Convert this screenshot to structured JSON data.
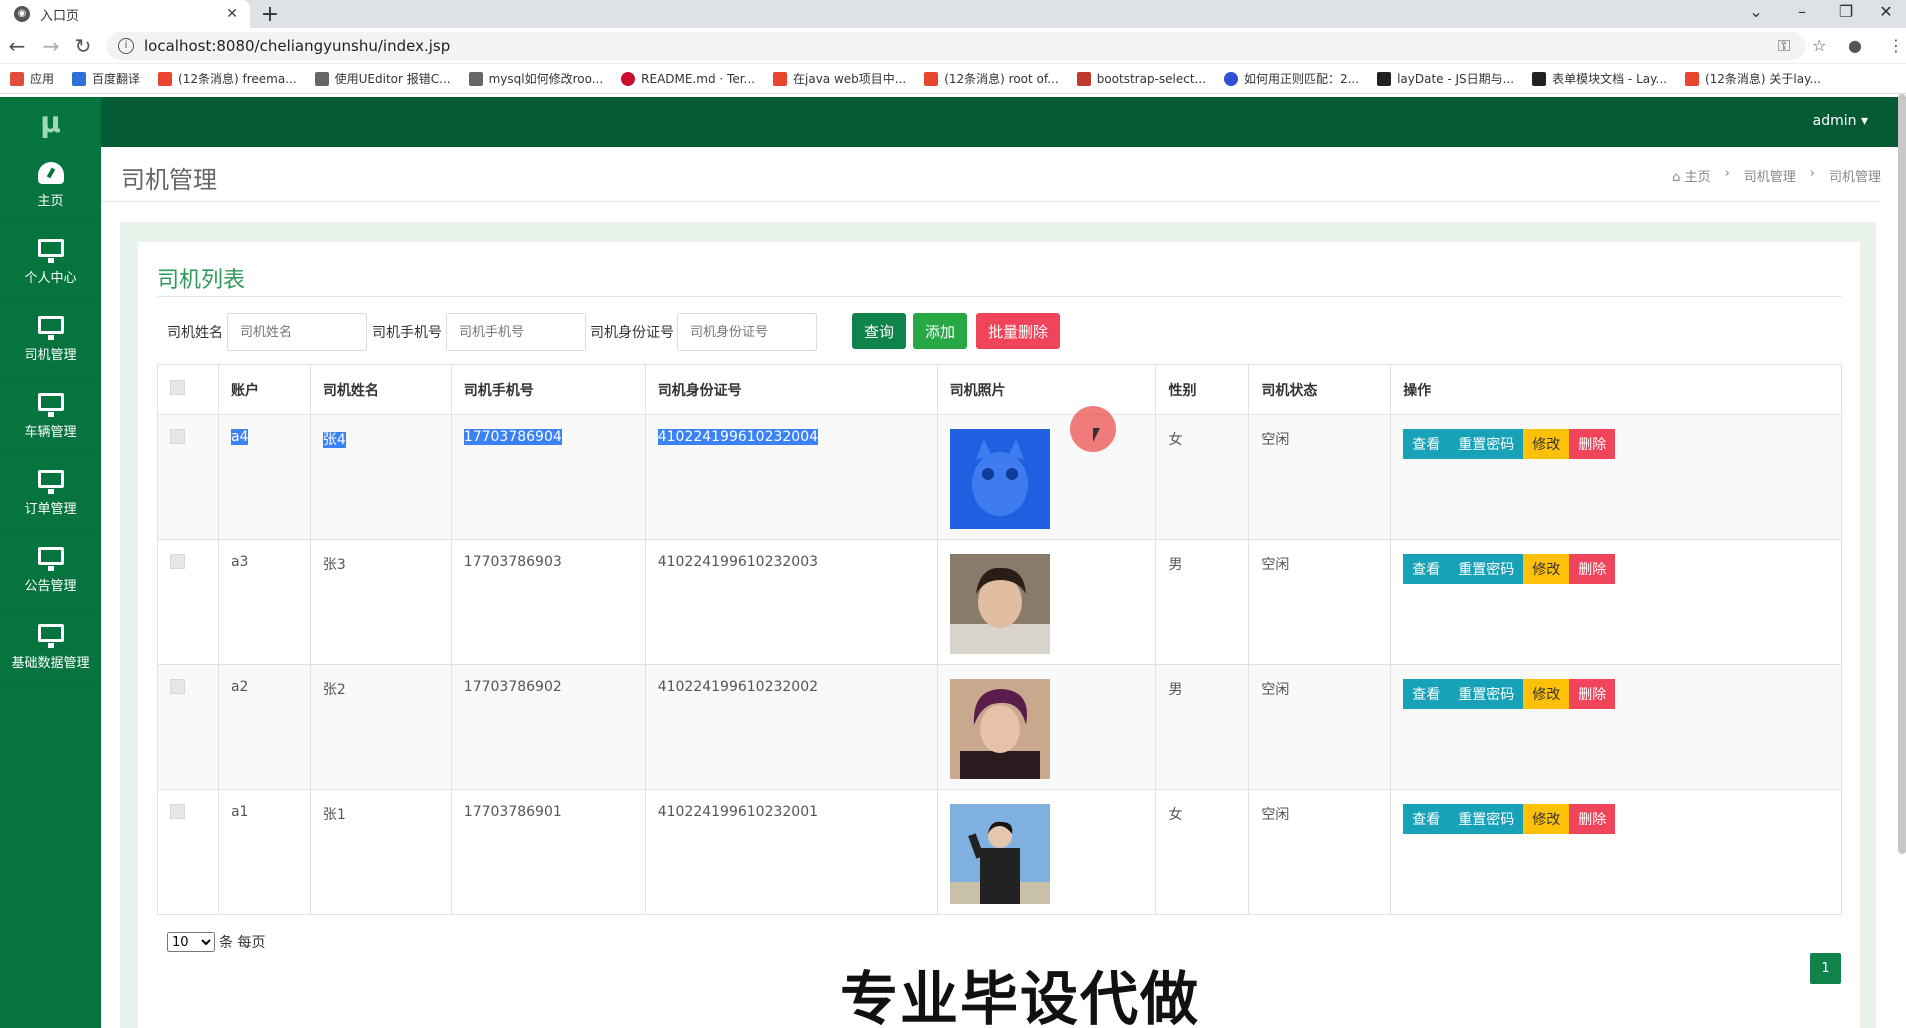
{
  "browser": {
    "tab_title": "入口页",
    "url": "localhost:8080/cheliangyunshu/index.jsp",
    "bookmarks": [
      "应用",
      "百度翻译",
      "(12条消息) freema...",
      "使用UEditor 报错C...",
      "mysql如何修改roo...",
      "README.md · Ter...",
      "在java web项目中...",
      "(12条消息) root of...",
      "bootstrap-select...",
      "如何用正则匹配：2...",
      "layDate - JS日期与...",
      "表单模块文档 - Lay...",
      "(12条消息) 关于lay..."
    ]
  },
  "sidebar": {
    "logo": "μ",
    "items": [
      {
        "label": "主页",
        "icon": "dashboard-icon"
      },
      {
        "label": "个人中心",
        "icon": "monitor-icon"
      },
      {
        "label": "司机管理",
        "icon": "monitor-icon"
      },
      {
        "label": "车辆管理",
        "icon": "monitor-icon"
      },
      {
        "label": "订单管理",
        "icon": "monitor-icon"
      },
      {
        "label": "公告管理",
        "icon": "monitor-icon"
      },
      {
        "label": "基础数据管理",
        "icon": "monitor-icon"
      }
    ]
  },
  "topbar": {
    "user": "admin ▾"
  },
  "page": {
    "title": "司机管理",
    "breadcrumb": [
      "主页",
      "›",
      "司机管理",
      "›",
      "司机管理"
    ]
  },
  "panel": {
    "title": "司机列表",
    "filters": [
      {
        "label": "司机姓名",
        "placeholder": "司机姓名"
      },
      {
        "label": "司机手机号",
        "placeholder": "司机手机号"
      },
      {
        "label": "司机身份证号",
        "placeholder": "司机身份证号"
      }
    ],
    "buttons": {
      "query": "查询",
      "add": "添加",
      "batch_delete": "批量删除"
    }
  },
  "table": {
    "headers": [
      "账户",
      "司机姓名",
      "司机手机号",
      "司机身份证号",
      "司机照片",
      "性别",
      "司机状态",
      "操作"
    ],
    "rows": [
      {
        "account": "a4",
        "name": "张4",
        "phone": "17703786904",
        "idcard": "410224199610232004",
        "gender": "女",
        "status": "空闲"
      },
      {
        "account": "a3",
        "name": "张3",
        "phone": "17703786903",
        "idcard": "410224199610232003",
        "gender": "男",
        "status": "空闲"
      },
      {
        "account": "a2",
        "name": "张2",
        "phone": "17703786902",
        "idcard": "410224199610232002",
        "gender": "男",
        "status": "空闲"
      },
      {
        "account": "a1",
        "name": "张1",
        "phone": "17703786901",
        "idcard": "410224199610232001",
        "gender": "女",
        "status": "空闲"
      }
    ],
    "actions": {
      "view": "查看",
      "reset_password": "重置密码",
      "edit": "修改",
      "delete": "删除"
    }
  },
  "pager": {
    "page_size": "10",
    "suffix": "条 每页",
    "current_page": "1"
  },
  "overlay": {
    "watermark": "专业毕设代做"
  },
  "colors": {
    "sidebar": "#05743f",
    "topbar": "#055a36",
    "view": "#17a2b8",
    "edit": "#ffc107",
    "delete": "#f0445a",
    "query": "#10834a",
    "add": "#28a745",
    "batch_delete": "#f0445a"
  }
}
